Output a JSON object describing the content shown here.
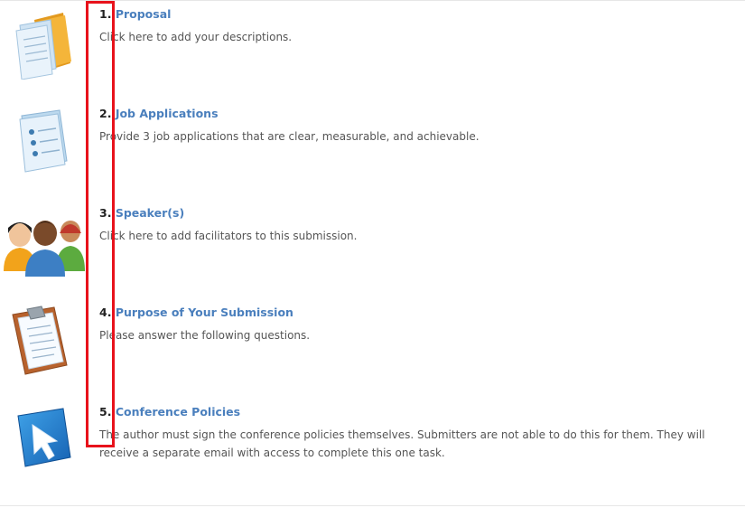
{
  "steps": [
    {
      "number": "1.",
      "title": "Proposal",
      "description": "Click here to add your descriptions.",
      "icon": "folder-documents-icon"
    },
    {
      "number": "2.",
      "title": "Job Applications",
      "description": "Provide 3 job applications that are clear, measurable, and achievable.",
      "icon": "list-document-icon"
    },
    {
      "number": "3.",
      "title": "Speaker(s)",
      "description": "Click here to add facilitators to this submission.",
      "icon": "people-group-icon"
    },
    {
      "number": "4.",
      "title": "Purpose of Your Submission",
      "description": "Please answer the following questions.",
      "icon": "clipboard-icon"
    },
    {
      "number": "5.",
      "title": "Conference Policies",
      "description": "The author must sign the conference policies themselves. Submitters are not able to do this for them. They will receive a separate email with access to complete this one task.",
      "icon": "cursor-arrow-icon"
    }
  ],
  "colors": {
    "link": "#4a7fbd",
    "highlight": "#e8121b",
    "text": "#555555"
  }
}
